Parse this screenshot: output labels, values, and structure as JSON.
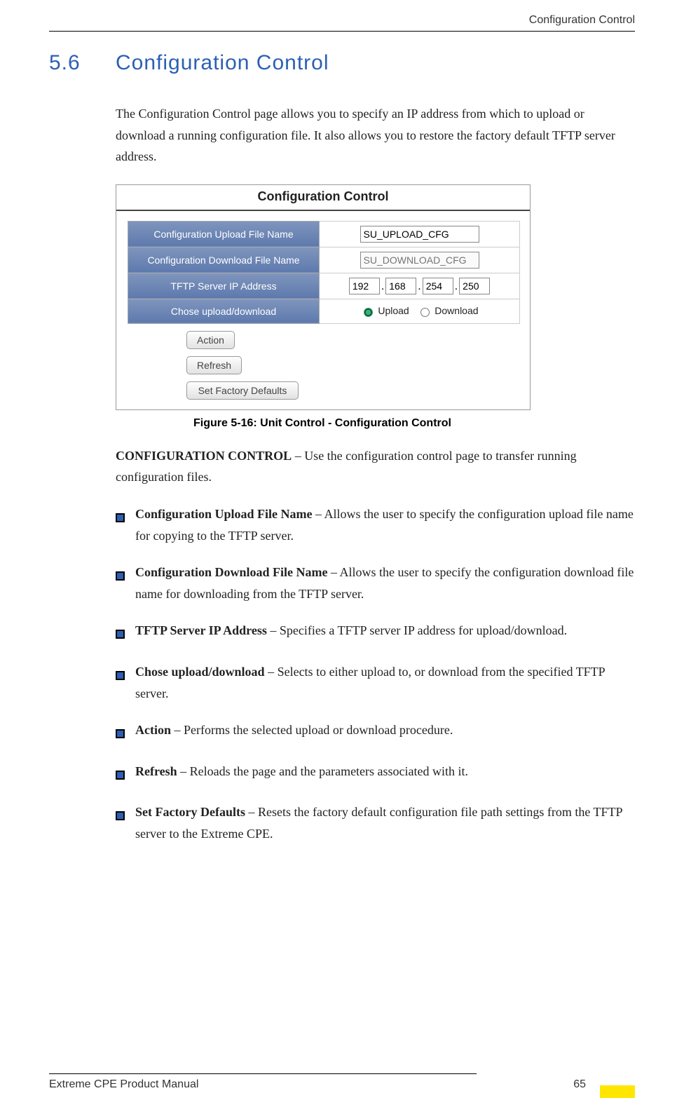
{
  "header": {
    "right_text": "Configuration Control"
  },
  "section": {
    "number": "5.6",
    "title": "Configuration Control"
  },
  "intro": "The Configuration Control page allows you to specify an IP address from which to upload or download a running configuration file. It also allows you to restore the factory default TFTP server address.",
  "figure": {
    "panel_title": "Configuration Control",
    "rows": {
      "upload_label": "Configuration Upload File Name",
      "upload_value": "SU_UPLOAD_CFG",
      "download_label": "Configuration Download File Name",
      "download_placeholder": "SU_DOWNLOAD_CFG",
      "tftp_label": "TFTP Server IP Address",
      "ip": {
        "a": "192",
        "b": "168",
        "c": "254",
        "d": "250"
      },
      "choose_label": "Chose upload/download",
      "radio_upload": "Upload",
      "radio_download": "Download"
    },
    "buttons": {
      "action": "Action",
      "refresh": "Refresh",
      "defaults": "Set Factory Defaults"
    },
    "caption": "Figure 5-16: Unit Control - Configuration Control"
  },
  "definitions": {
    "lead_bold": "CONFIGURATION CONTROL",
    "lead_rest": " – Use the configuration control page to transfer running configuration files."
  },
  "bullets": [
    {
      "bold": "Configuration Upload File Name",
      "rest": " – Allows the user to specify the configuration upload file name for copying to the TFTP server."
    },
    {
      "bold": "Configuration Download File Name",
      "rest": " – Allows the user to specify the configuration download file name for downloading from the TFTP server."
    },
    {
      "bold": "TFTP Server IP Address",
      "rest": " – Specifies a TFTP server IP address for upload/download."
    },
    {
      "bold": "Chose upload/download",
      "rest": " – Selects to either upload to, or download from the specified TFTP server."
    },
    {
      "bold": "Action",
      "rest": " – Performs the selected upload or download procedure."
    },
    {
      "bold": "Refresh",
      "rest": " – Reloads the page and the parameters associated with it."
    },
    {
      "bold": "Set Factory Defaults",
      "rest": " – Resets the factory default configuration file path settings from the TFTP server to the Extreme CPE."
    }
  ],
  "footer": {
    "left": "Extreme CPE Product Manual",
    "page": "65"
  }
}
